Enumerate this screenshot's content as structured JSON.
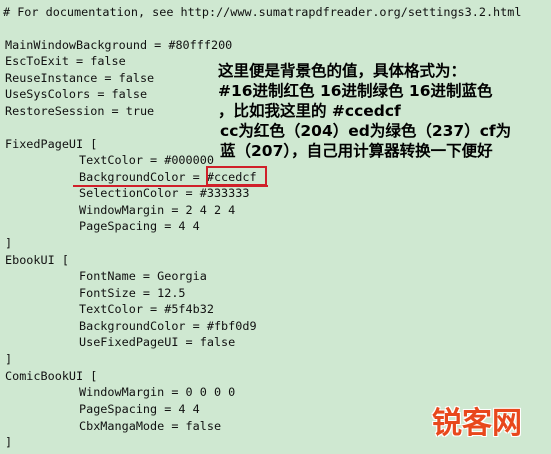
{
  "lines": [
    "# For documentation, see http://www.sumatrapdfreader.org/settings3.2.html",
    "MainWindowBackground = #80fff200",
    "EscToExit = false",
    "ReuseInstance = false",
    "UseSysColors = false",
    "RestoreSession = true",
    "FixedPageUI [",
    "TextColor = #000000",
    "BackgroundColor = ",
    "#ccedcf",
    "SelectionColor = #333333",
    "WindowMargin = 2 4 2 4",
    "PageSpacing = 4 4",
    "]",
    "EbookUI [",
    "FontName = Georgia",
    "FontSize = 12.5",
    "TextColor = #5f4b32",
    "BackgroundColor = #fbf0d9",
    "UseFixedPageUI = false",
    "]",
    "ComicBookUI [",
    "WindowMargin = 0 0 0 0",
    "PageSpacing = 4 4",
    "CbxMangaMode = false",
    "]"
  ],
  "annotation": [
    "这里便是背景色的值，具体格式为：",
    "#16进制红色 16进制绿色 16进制蓝色",
    "，比如我这里的 #ccedcf",
    "cc为红色（204）ed为绿色（237）cf为",
    "蓝（207），自己用计算器转换一下便好"
  ],
  "watermark": "锐客网",
  "colors": {
    "editor_background": "#cfe8d1",
    "highlight": "#d0202a",
    "watermark": "#e8481c"
  }
}
